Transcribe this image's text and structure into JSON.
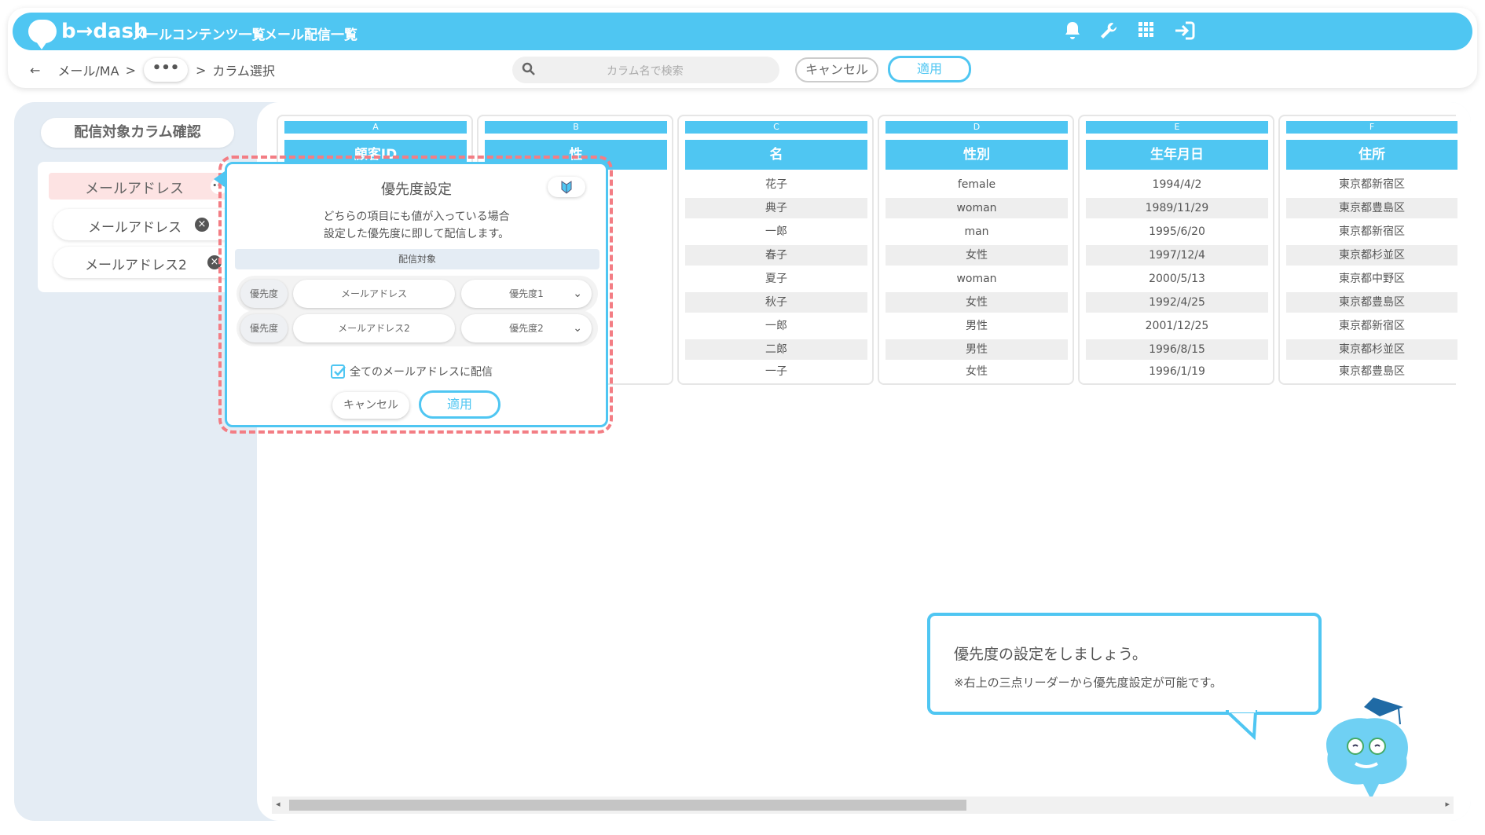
{
  "app": {
    "brand": "b→dash"
  },
  "nav": {
    "items": [
      "メールコンテンツ一覧",
      "メール配信一覧"
    ]
  },
  "top_icons": [
    "bell-icon",
    "wrench-icon",
    "grid-icon",
    "logout-icon"
  ],
  "breadcrumb": {
    "back": "←",
    "root": "メール/MA",
    "sep1": ">",
    "more": "•••",
    "sep2": ">",
    "current": "カラム選択"
  },
  "search": {
    "placeholder": "カラム名で検索"
  },
  "toolbar": {
    "cancel": "キャンセル",
    "apply": "適用"
  },
  "left_panel": {
    "title": "配信対象カラム確認",
    "items": [
      {
        "label": "メールアドレス",
        "selected": true,
        "more": "•••"
      },
      {
        "label": "メールアドレス",
        "selected": false
      },
      {
        "label": "メールアドレス2",
        "selected": false
      }
    ]
  },
  "table": {
    "columns": [
      {
        "letter": "A",
        "header": "顧客ID"
      },
      {
        "letter": "B",
        "header": "性"
      },
      {
        "letter": "C",
        "header": "名"
      },
      {
        "letter": "D",
        "header": "性別"
      },
      {
        "letter": "E",
        "header": "生年月日"
      },
      {
        "letter": "F",
        "header": "住所"
      }
    ],
    "rows": [
      [
        "",
        "",
        "花子",
        "female",
        "1994/4/2",
        "東京都新宿区"
      ],
      [
        "",
        "",
        "典子",
        "woman",
        "1989/11/29",
        "東京都豊島区"
      ],
      [
        "",
        "",
        "一郎",
        "man",
        "1995/6/20",
        "東京都新宿区"
      ],
      [
        "",
        "",
        "春子",
        "女性",
        "1997/12/4",
        "東京都杉並区"
      ],
      [
        "",
        "",
        "夏子",
        "woman",
        "2000/5/13",
        "東京都中野区"
      ],
      [
        "",
        "",
        "秋子",
        "女性",
        "1992/4/25",
        "東京都豊島区"
      ],
      [
        "",
        "",
        "一郎",
        "男性",
        "2001/12/25",
        "東京都新宿区"
      ],
      [
        "",
        "",
        "二郎",
        "男性",
        "1996/8/15",
        "東京都杉並区"
      ],
      [
        "",
        "",
        "一子",
        "女性",
        "1996/1/19",
        "東京都豊島区"
      ]
    ]
  },
  "popup": {
    "title": "優先度設定",
    "description_line1": "どちらの項目にも値が入っている場合",
    "description_line2": "設定した優先度に即して配信します。",
    "section_label": "配信対象",
    "rows": [
      {
        "tag": "優先度",
        "field": "メールアドレス",
        "priority": "優先度1"
      },
      {
        "tag": "優先度",
        "field": "メールアドレス2",
        "priority": "優先度2"
      }
    ],
    "checkbox_label": "全てのメールアドレスに配信",
    "checkbox_checked": true,
    "cancel": "キャンセル",
    "apply": "適用"
  },
  "tooltip": {
    "line1": "優先度の設定をしましょう。",
    "line2": "※右上の三点リーダーから優先度設定が可能です。"
  },
  "colors": {
    "accent": "#4fc6f2",
    "highlight": "#f37d84",
    "selected_bg": "#fde3e3"
  }
}
